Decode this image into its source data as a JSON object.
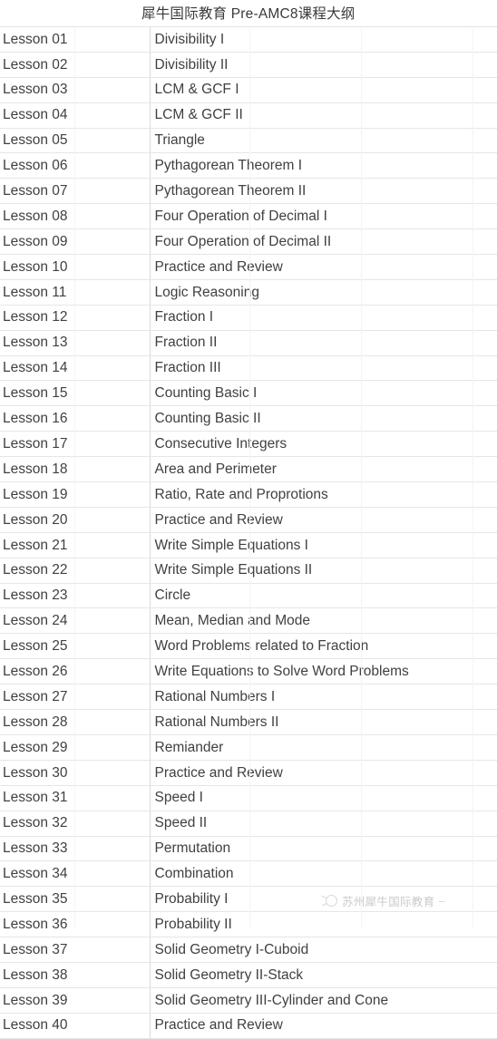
{
  "document": {
    "title": "犀牛国际教育 Pre-AMC8课程大纲"
  },
  "table": {
    "columns": [
      {
        "key": "lesson",
        "header": ""
      },
      {
        "key": "topic",
        "header": ""
      }
    ],
    "rows": [
      {
        "lesson": "Lesson 01",
        "topic": "Divisibility I"
      },
      {
        "lesson": "Lesson 02",
        "topic": "Divisibility II"
      },
      {
        "lesson": "Lesson 03",
        "topic": "LCM & GCF I"
      },
      {
        "lesson": "Lesson 04",
        "topic": "LCM & GCF II"
      },
      {
        "lesson": "Lesson 05",
        "topic": "Triangle"
      },
      {
        "lesson": "Lesson 06",
        "topic": "Pythagorean Theorem I"
      },
      {
        "lesson": "Lesson 07",
        "topic": "Pythagorean Theorem II"
      },
      {
        "lesson": "Lesson 08",
        "topic": "Four Operation of Decimal I"
      },
      {
        "lesson": "Lesson 09",
        "topic": "Four Operation of Decimal II"
      },
      {
        "lesson": "Lesson 10",
        "topic": "Practice and Review"
      },
      {
        "lesson": "Lesson 11",
        "topic": "Logic Reasoning"
      },
      {
        "lesson": "Lesson 12",
        "topic": "Fraction I"
      },
      {
        "lesson": "Lesson 13",
        "topic": "Fraction II"
      },
      {
        "lesson": "Lesson 14",
        "topic": "Fraction III"
      },
      {
        "lesson": "Lesson 15",
        "topic": "Counting Basic I"
      },
      {
        "lesson": "Lesson 16",
        "topic": "Counting Basic II"
      },
      {
        "lesson": "Lesson 17",
        "topic": "Consecutive Integers"
      },
      {
        "lesson": "Lesson 18",
        "topic": "Area and Perimeter"
      },
      {
        "lesson": "Lesson 19",
        "topic": "Ratio, Rate and Proprotions"
      },
      {
        "lesson": "Lesson 20",
        "topic": "Practice and Review"
      },
      {
        "lesson": "Lesson 21",
        "topic": "Write Simple Equations I"
      },
      {
        "lesson": "Lesson 22",
        "topic": "Write Simple Equations II"
      },
      {
        "lesson": "Lesson 23",
        "topic": "Circle"
      },
      {
        "lesson": "Lesson 24",
        "topic": "Mean, Median and Mode"
      },
      {
        "lesson": "Lesson 25",
        "topic": "Word Problems related to Fraction"
      },
      {
        "lesson": "Lesson 26",
        "topic": "Write Equations to Solve Word Problems"
      },
      {
        "lesson": "Lesson 27",
        "topic": "Rational Numbers I"
      },
      {
        "lesson": "Lesson 28",
        "topic": "Rational Numbers II"
      },
      {
        "lesson": "Lesson 29",
        "topic": "Remiander"
      },
      {
        "lesson": "Lesson 30",
        "topic": "Practice and Review"
      },
      {
        "lesson": "Lesson 31",
        "topic": "Speed I"
      },
      {
        "lesson": "Lesson 32",
        "topic": "Speed II"
      },
      {
        "lesson": "Lesson 33",
        "topic": "Permutation"
      },
      {
        "lesson": "Lesson 34",
        "topic": "Combination"
      },
      {
        "lesson": "Lesson 35",
        "topic": "Probability I"
      },
      {
        "lesson": "Lesson 36",
        "topic": "Probability II"
      },
      {
        "lesson": "Lesson 37",
        "topic": "Solid Geometry I-Cuboid"
      },
      {
        "lesson": "Lesson 38",
        "topic": "Solid Geometry II-Stack"
      },
      {
        "lesson": "Lesson 39",
        "topic": "Solid Geometry III-Cylinder and Cone"
      },
      {
        "lesson": "Lesson 40",
        "topic": "Practice and Review"
      }
    ]
  },
  "watermark": {
    "icon": "rhino-circle-logo-icon",
    "text": "苏州犀牛国际教育",
    "trailing": "--"
  },
  "colors": {
    "text": "#404040",
    "grid_line": "#e6e6e6",
    "column_divider": "#d9d9d9",
    "watermark_text": "#9e9e9e",
    "background": "#ffffff"
  }
}
